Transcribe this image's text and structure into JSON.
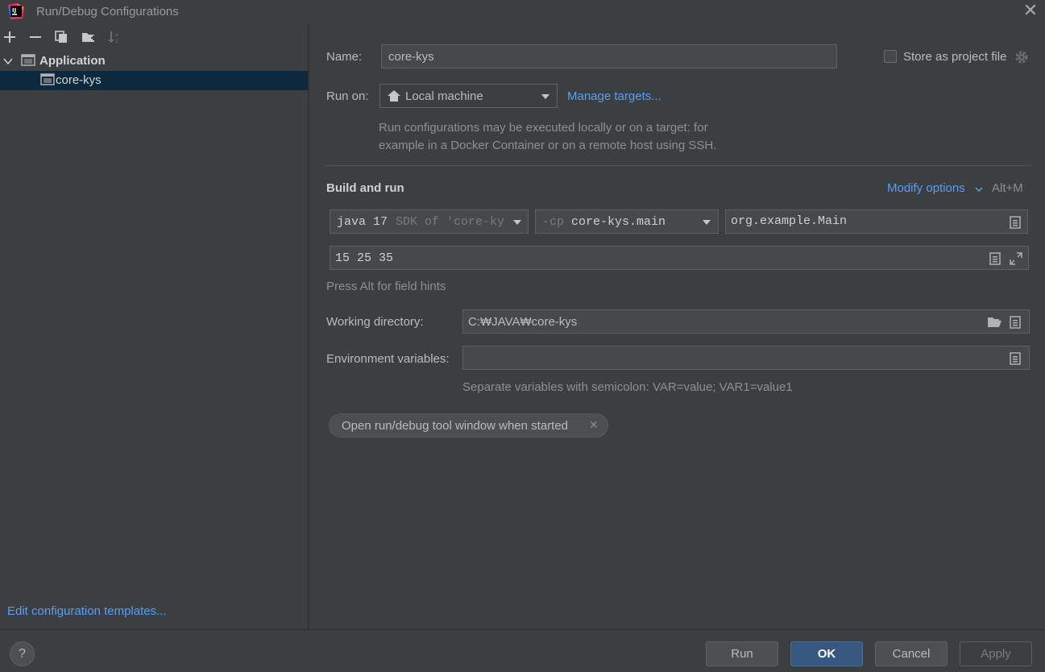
{
  "window": {
    "title": "Run/Debug Configurations"
  },
  "left_panel": {
    "toolbar": {
      "add": "add-icon",
      "remove": "remove-icon",
      "copy": "copy-icon",
      "folder": "new-folder-icon",
      "sort": "sort-icon"
    },
    "tree": {
      "group_label": "Application",
      "item_label": "core-kys"
    },
    "edit_templates": "Edit configuration templates..."
  },
  "form": {
    "name_label": "Name:",
    "name_value": "core-kys",
    "store_label": "Store as project file",
    "run_on_label": "Run on:",
    "run_on_value": "Local machine",
    "manage_targets": "Manage targets...",
    "run_hint_line1": "Run configurations may be executed locally or on a target: for",
    "run_hint_line2": "example in a Docker Container or on a remote host using SSH.",
    "build_run_title": "Build and run",
    "modify_options": "Modify options",
    "modify_shortcut": "Alt+M",
    "jdk_main": "java 17",
    "jdk_sub": "SDK of 'core-ky",
    "cp_prefix": "-cp",
    "cp_value": "core-kys.main",
    "main_class": "org.example.Main",
    "program_args": "15 25 35",
    "field_hints": "Press Alt for field hints",
    "working_dir_label": "Working directory:",
    "working_dir_value": "C:₩JAVA₩core-kys",
    "env_label": "Environment variables:",
    "env_value": "",
    "env_hint": "Separate variables with semicolon: VAR=value; VAR1=value1",
    "chip_label": "Open run/debug tool window when started"
  },
  "buttons": {
    "help": "?",
    "run": "Run",
    "ok": "OK",
    "cancel": "Cancel",
    "apply": "Apply"
  },
  "colors": {
    "background": "#3c3f41",
    "selection": "#0d293e",
    "link": "#589df6",
    "primary_button": "#365880"
  }
}
